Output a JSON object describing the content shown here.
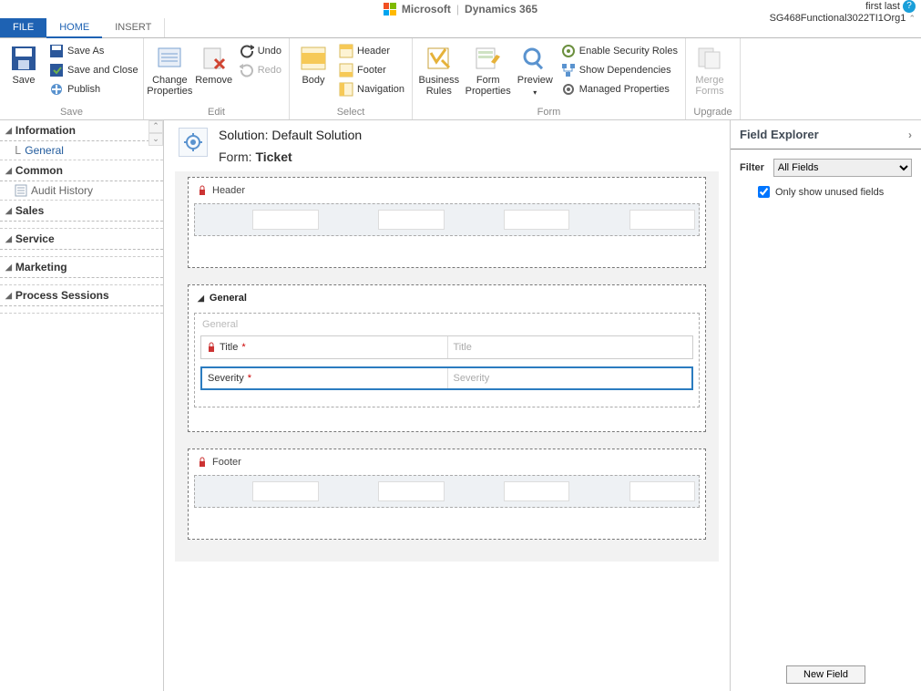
{
  "brand": {
    "company": "Microsoft",
    "product": "Dynamics 365"
  },
  "user": {
    "name": "first last",
    "org": "SG468Functional3022TI1Org1"
  },
  "tabs": {
    "file": "FILE",
    "home": "HOME",
    "insert": "INSERT"
  },
  "ribbon": {
    "save": {
      "save": "Save",
      "saveas": "Save As",
      "saveclose": "Save and Close",
      "publish": "Publish",
      "group": "Save"
    },
    "edit": {
      "changeprops": "Change\nProperties",
      "remove": "Remove",
      "undo": "Undo",
      "redo": "Redo",
      "group": "Edit"
    },
    "select": {
      "body": "Body",
      "header": "Header",
      "footer": "Footer",
      "navigation": "Navigation",
      "group": "Select"
    },
    "form": {
      "bizrules": "Business\nRules",
      "formprops": "Form\nProperties",
      "preview": "Preview",
      "security": "Enable Security Roles",
      "deps": "Show Dependencies",
      "managed": "Managed Properties",
      "group": "Form"
    },
    "upgrade": {
      "merge": "Merge\nForms",
      "group": "Upgrade"
    }
  },
  "nav": {
    "information": "Information",
    "general": "General",
    "common": "Common",
    "audit": "Audit History",
    "sales": "Sales",
    "service": "Service",
    "marketing": "Marketing",
    "process": "Process Sessions"
  },
  "form": {
    "sol_lbl": "Solution:",
    "sol_name": "Default Solution",
    "form_lbl": "Form:",
    "form_name": "Ticket",
    "header": "Header",
    "footer": "Footer",
    "general": "General",
    "generalSub": "General",
    "fields": {
      "title": {
        "label": "Title",
        "placeholder": "Title"
      },
      "severity": {
        "label": "Severity",
        "placeholder": "Severity"
      }
    }
  },
  "explorer": {
    "title": "Field Explorer",
    "filter_lbl": "Filter",
    "filter_val": "All Fields",
    "unused": "Only show unused fields",
    "newfield": "New Field"
  }
}
